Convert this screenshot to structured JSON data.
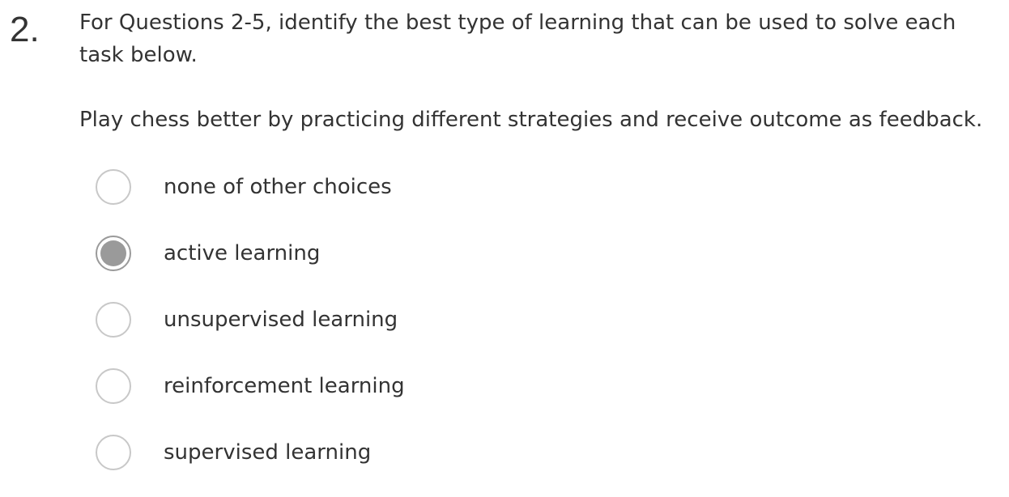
{
  "question": {
    "number": "2.",
    "intro": "For Questions 2-5, identify the best type of learning that can be used to solve each task below.",
    "prompt": "Play chess better by practicing different strategies and receive outcome as feedback.",
    "options": [
      {
        "label": "none of other choices",
        "selected": false
      },
      {
        "label": "active learning",
        "selected": true
      },
      {
        "label": "unsupervised learning",
        "selected": false
      },
      {
        "label": "reinforcement learning",
        "selected": false
      },
      {
        "label": "supervised learning",
        "selected": false
      }
    ]
  },
  "colors": {
    "text": "#333333",
    "radio_border": "#c8c8c8",
    "radio_selected_fill": "#9a9a9a"
  }
}
